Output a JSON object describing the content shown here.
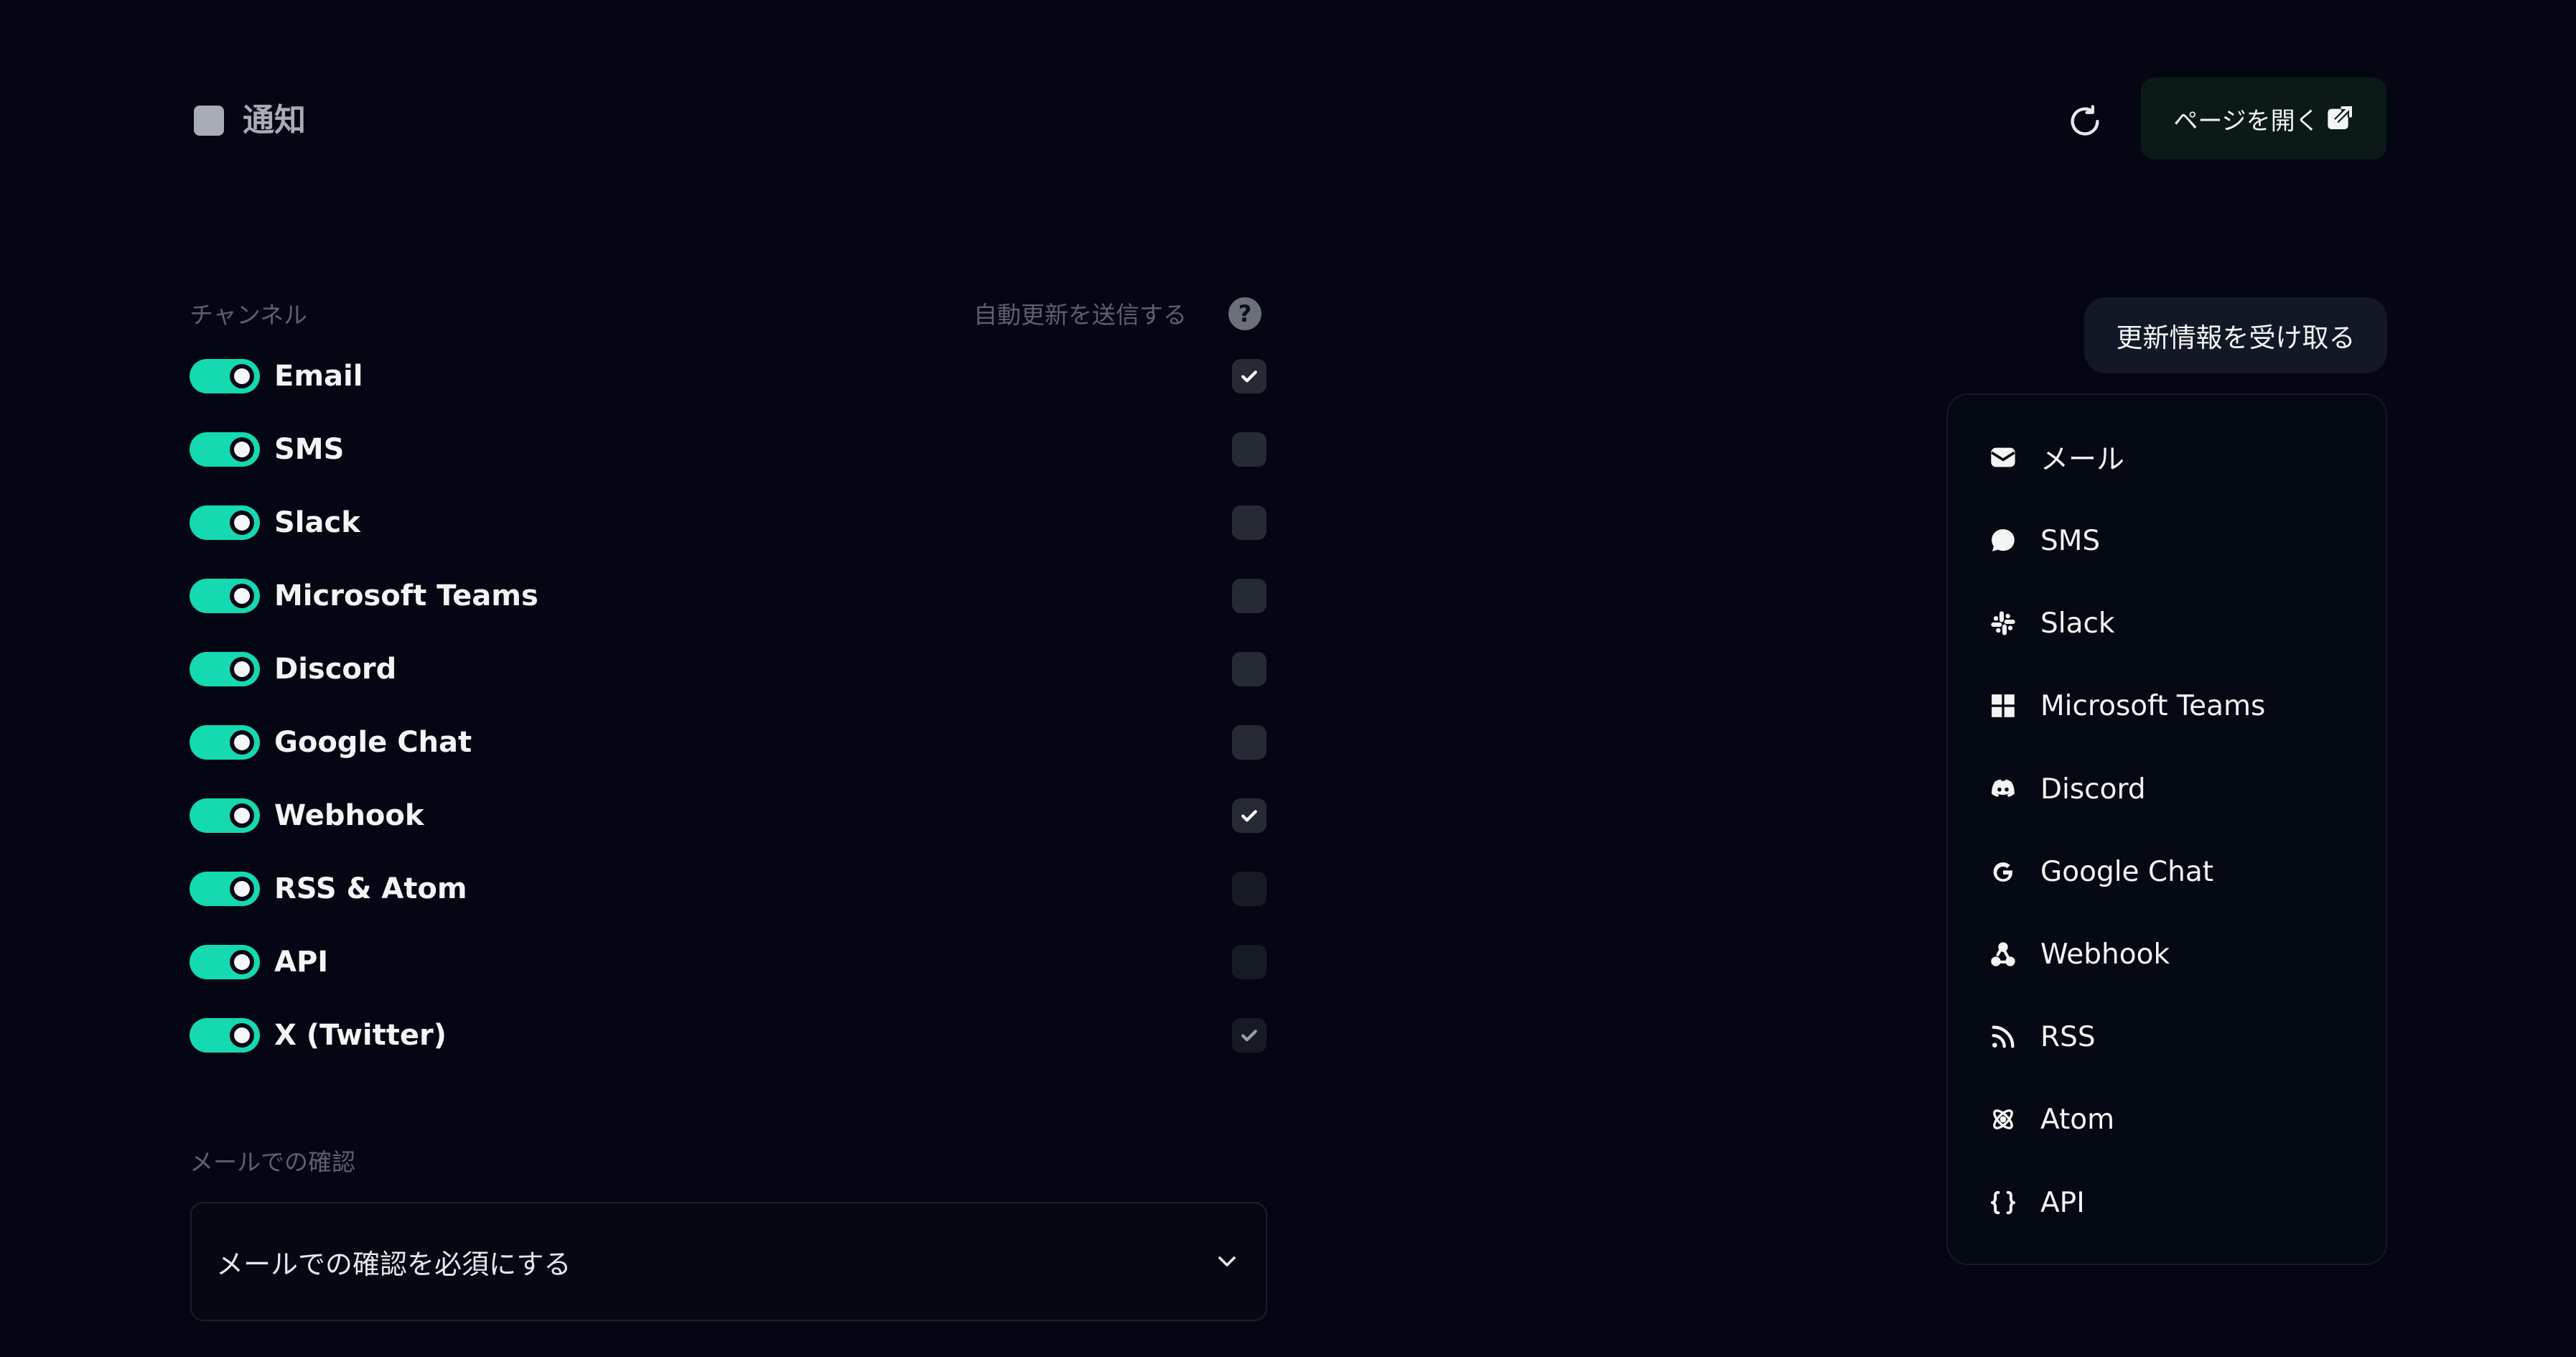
{
  "header": {
    "title": "通知",
    "open_page_label": "ページを開く"
  },
  "channels": {
    "section_label": "チャンネル",
    "auto_update_label": "自動更新を送信する",
    "help_glyph": "?",
    "items": [
      {
        "name": "Email",
        "enabled": true,
        "auto_update": true
      },
      {
        "name": "SMS",
        "enabled": true,
        "auto_update": false
      },
      {
        "name": "Slack",
        "enabled": true,
        "auto_update": false
      },
      {
        "name": "Microsoft Teams",
        "enabled": true,
        "auto_update": false
      },
      {
        "name": "Discord",
        "enabled": true,
        "auto_update": false
      },
      {
        "name": "Google Chat",
        "enabled": true,
        "auto_update": false
      },
      {
        "name": "Webhook",
        "enabled": true,
        "auto_update": true
      },
      {
        "name": "RSS & Atom",
        "enabled": true,
        "auto_update": false
      },
      {
        "name": "API",
        "enabled": true,
        "auto_update": false
      },
      {
        "name": "X (Twitter)",
        "enabled": true,
        "auto_update": true
      }
    ]
  },
  "email_confirmation": {
    "section_label": "メールでの確認",
    "selected": "メールでの確認を必須にする"
  },
  "subscribe": {
    "button_label": "更新情報を受け取る",
    "menu": [
      {
        "label": "メール",
        "icon": "envelope-icon"
      },
      {
        "label": "SMS",
        "icon": "chat-bubble-icon"
      },
      {
        "label": "Slack",
        "icon": "slack-icon"
      },
      {
        "label": "Microsoft Teams",
        "icon": "windows-icon"
      },
      {
        "label": "Discord",
        "icon": "discord-icon"
      },
      {
        "label": "Google Chat",
        "icon": "google-icon"
      },
      {
        "label": "Webhook",
        "icon": "webhook-icon"
      },
      {
        "label": "RSS",
        "icon": "rss-icon"
      },
      {
        "label": "Atom",
        "icon": "atom-icon"
      },
      {
        "label": "API",
        "icon": "braces-icon"
      }
    ]
  },
  "colors": {
    "accent": "#14d9b1",
    "background": "#040713",
    "muted_text": "#5b606c"
  }
}
